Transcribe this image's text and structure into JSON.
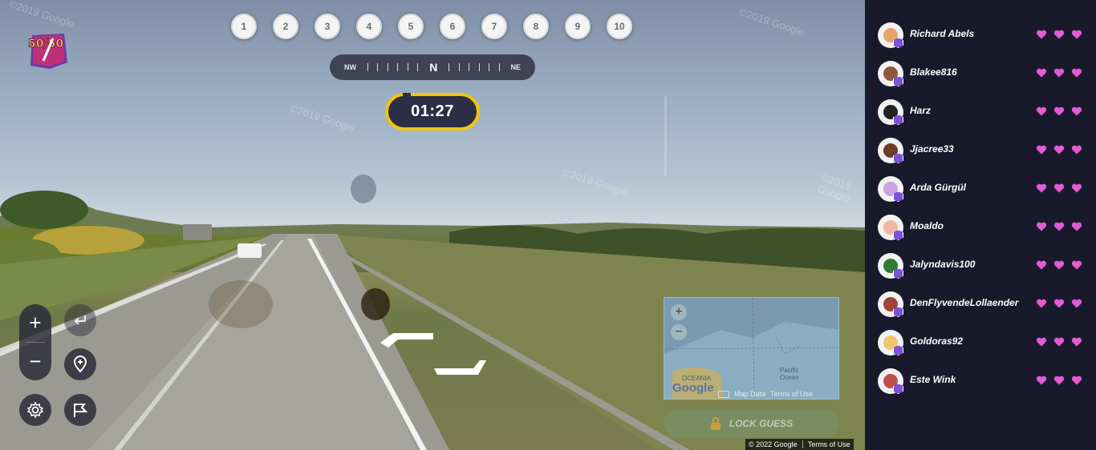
{
  "logo": {
    "text": "50/50",
    "icon": "fifty-fifty-logo-icon"
  },
  "rounds": [
    "1",
    "2",
    "3",
    "4",
    "5",
    "6",
    "7",
    "8",
    "9",
    "10"
  ],
  "compass": {
    "left": "NW",
    "center": "N",
    "right": "NE"
  },
  "timer": "01:27",
  "watermarks": [
    "©2019 Google",
    "©2019 Google",
    "©2019 Google",
    "©2019 Google",
    "©2019 Google"
  ],
  "controls": {
    "zoom_in": "+",
    "zoom_out": "−",
    "undo_icon": "undo-arrow-icon",
    "pin_icon": "location-pin-icon",
    "settings_icon": "gear-icon",
    "flag_icon": "flag-icon"
  },
  "minimap": {
    "zoom_in": "+",
    "zoom_out": "−",
    "region_label": "OCEANIA",
    "ocean_label": "Pacific\nOcean",
    "map_data": "Map Data",
    "terms": "Terms of Use",
    "google": "Google"
  },
  "lock_guess": {
    "label": "LOCK GUESS",
    "icon": "lock-icon"
  },
  "copyright": {
    "text": "© 2022 Google",
    "terms": "Terms of Use"
  },
  "colors": {
    "accent": "#f1c40f",
    "heart": "#e35ad6",
    "badge": "#7e52d6",
    "sidebar_bg": "#181a2b"
  },
  "players": [
    {
      "name": "Richard Abels",
      "lives": 3,
      "face": "#e7a36a"
    },
    {
      "name": "Blakee816",
      "lives": 3,
      "face": "#8a5a3b"
    },
    {
      "name": "Harz",
      "lives": 3,
      "face": "#222222"
    },
    {
      "name": "Jjacree33",
      "lives": 3,
      "face": "#6b3c2a"
    },
    {
      "name": "Arda Gürgül",
      "lives": 3,
      "face": "#c9a3e6"
    },
    {
      "name": "Moaldo",
      "lives": 3,
      "face": "#f0b7a4"
    },
    {
      "name": "Jalyndavis100",
      "lives": 3,
      "face": "#2e7d32"
    },
    {
      "name": "DenFlyvendeLollaender",
      "lives": 3,
      "face": "#a0443a"
    },
    {
      "name": "Goldoras92",
      "lives": 3,
      "face": "#f2c46e"
    },
    {
      "name": "Este Wink",
      "lives": 3,
      "face": "#c0504d"
    }
  ]
}
